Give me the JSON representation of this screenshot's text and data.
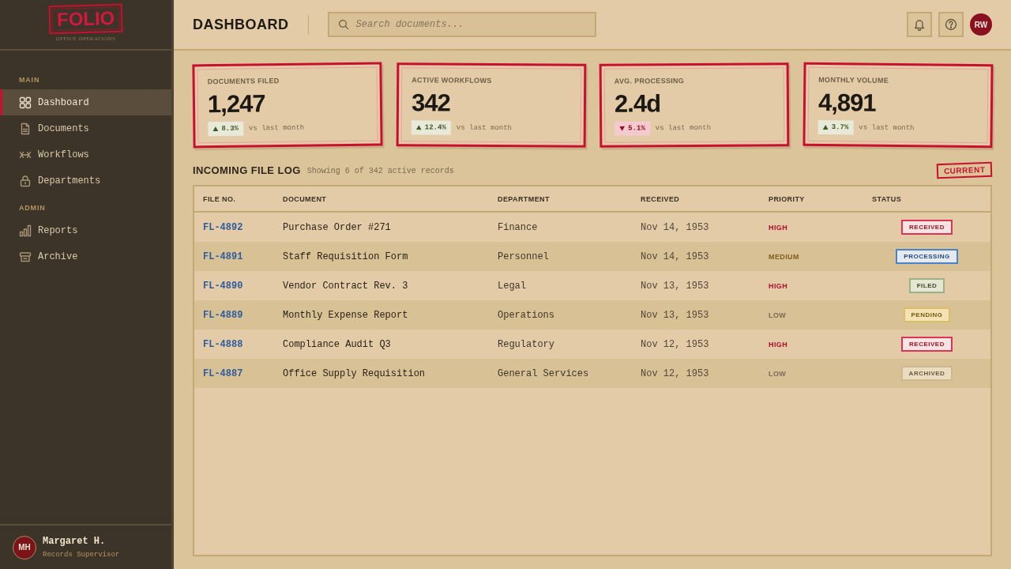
{
  "sidebar": {
    "logo": {
      "title": "FOLIO",
      "subtitle": "OFFICE OPERATIONS"
    },
    "sections": [
      {
        "heading": "MAIN",
        "items": [
          {
            "label": "Dashboard",
            "selected": true
          },
          {
            "label": "Documents",
            "selected": false
          },
          {
            "label": "Workflows",
            "selected": false
          },
          {
            "label": "Departments",
            "selected": false
          }
        ]
      },
      {
        "heading": "ADMIN",
        "items": [
          {
            "label": "Reports",
            "selected": false
          },
          {
            "label": "Archive",
            "selected": false
          }
        ]
      }
    ],
    "user": {
      "initials": "MH",
      "name": "Margaret H.",
      "role": "Records Supervisor"
    }
  },
  "header": {
    "title": "DASHBOARD",
    "search": {
      "placeholder": "Search documents..."
    },
    "avatar": {
      "initials": "RW"
    }
  },
  "stats": [
    {
      "label": "DOCUMENTS FILED",
      "value": "1,247",
      "change": {
        "kind": "up",
        "text": "8.3%"
      },
      "note": "vs last month"
    },
    {
      "label": "ACTIVE WORKFLOWS",
      "value": "342",
      "change": {
        "kind": "up",
        "text": "12.4%"
      },
      "note": "vs last month"
    },
    {
      "label": "AVG. PROCESSING",
      "value": "2.4d",
      "change": {
        "kind": "down",
        "text": "5.1%"
      },
      "note": "vs last month"
    },
    {
      "label": "MONTHLY VOLUME",
      "value": "4,891",
      "change": {
        "kind": "up",
        "text": "3.7%"
      },
      "note": "vs last month"
    }
  ],
  "file_log": {
    "title": "INCOMING FILE LOG",
    "subtitle": "Showing 6 of 342 active records",
    "stamp": "CURRENT",
    "columns": [
      "FILE NO.",
      "DOCUMENT",
      "DEPARTMENT",
      "RECEIVED",
      "PRIORITY",
      "STATUS"
    ],
    "rows": [
      {
        "file_no": "FL-4892",
        "document": "Purchase Order #271",
        "department": "Finance",
        "received": "Nov 14, 1953",
        "priority": {
          "label": "HIGH",
          "kind": "high"
        },
        "status": {
          "label": "RECEIVED",
          "kind": "received"
        }
      },
      {
        "file_no": "FL-4891",
        "document": "Staff Requisition Form",
        "department": "Personnel",
        "received": "Nov 14, 1953",
        "priority": {
          "label": "MEDIUM",
          "kind": "medium"
        },
        "status": {
          "label": "PROCESSING",
          "kind": "processing"
        }
      },
      {
        "file_no": "FL-4890",
        "document": "Vendor Contract Rev. 3",
        "department": "Legal",
        "received": "Nov 13, 1953",
        "priority": {
          "label": "HIGH",
          "kind": "high"
        },
        "status": {
          "label": "FILED",
          "kind": "filed"
        }
      },
      {
        "file_no": "FL-4889",
        "document": "Monthly Expense Report",
        "department": "Operations",
        "received": "Nov 13, 1953",
        "priority": {
          "label": "LOW",
          "kind": "low"
        },
        "status": {
          "label": "PENDING",
          "kind": "pending"
        }
      },
      {
        "file_no": "FL-4888",
        "document": "Compliance Audit Q3",
        "department": "Regulatory",
        "received": "Nov 12, 1953",
        "priority": {
          "label": "HIGH",
          "kind": "high"
        },
        "status": {
          "label": "RECEIVED",
          "kind": "received"
        }
      },
      {
        "file_no": "FL-4887",
        "document": "Office Supply Requisition",
        "department": "General Services",
        "received": "Nov 12, 1953",
        "priority": {
          "label": "LOW",
          "kind": "low"
        },
        "status": {
          "label": "ARCHIVED",
          "kind": "archived"
        }
      }
    ]
  }
}
